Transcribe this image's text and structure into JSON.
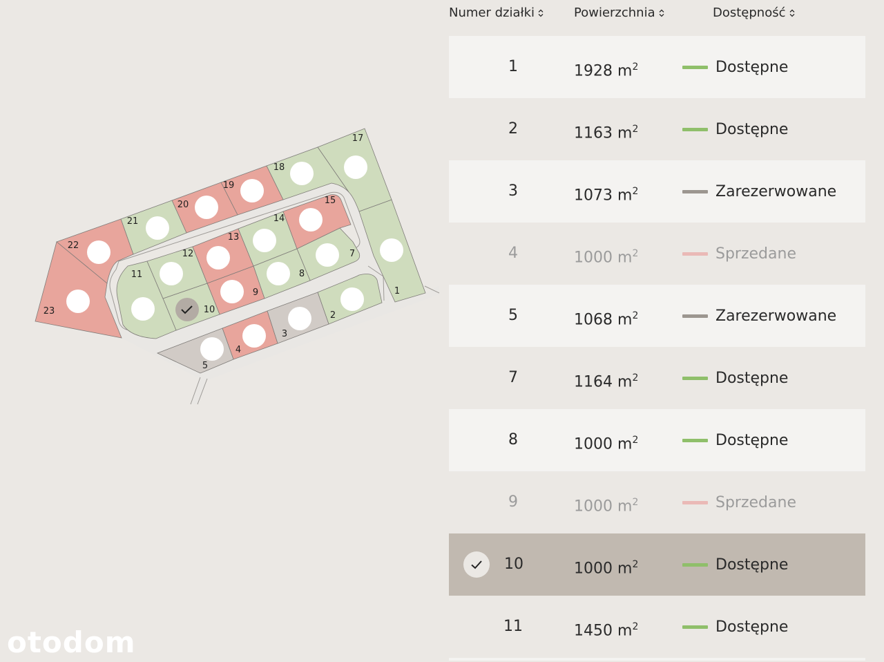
{
  "brand": {
    "logo_text": "otodom"
  },
  "table": {
    "headers": {
      "plot_number": "Numer działki",
      "area": "Powierzchnia",
      "availability": "Dostępność"
    },
    "area_unit": "m",
    "area_exp": "2",
    "rows": [
      {
        "number": "1",
        "area": "1928",
        "status": "Dostępne"
      },
      {
        "number": "2",
        "area": "1163",
        "status": "Dostępne"
      },
      {
        "number": "3",
        "area": "1073",
        "status": "Zarezerwowane"
      },
      {
        "number": "4",
        "area": "1000",
        "status": "Sprzedane"
      },
      {
        "number": "5",
        "area": "1068",
        "status": "Zarezerwowane"
      },
      {
        "number": "7",
        "area": "1164",
        "status": "Dostępne"
      },
      {
        "number": "8",
        "area": "1000",
        "status": "Dostępne"
      },
      {
        "number": "9",
        "area": "1000",
        "status": "Sprzedane"
      },
      {
        "number": "10",
        "area": "1000",
        "status": "Dostępne",
        "selected": true
      },
      {
        "number": "11",
        "area": "1450",
        "status": "Dostępne"
      }
    ]
  },
  "colors": {
    "available": "#8fbf6a",
    "reserved": "#9c9690",
    "sold": "#eab9b6",
    "plot_available": "#cfdcbd",
    "plot_sold": "#e8a59c",
    "plot_reserved": "#d1cbc6",
    "selected_row": "#c1b9b0"
  },
  "map": {
    "plots": [
      {
        "label": "1",
        "status": "available"
      },
      {
        "label": "2",
        "status": "available"
      },
      {
        "label": "3",
        "status": "reserved"
      },
      {
        "label": "4",
        "status": "sold"
      },
      {
        "label": "5",
        "status": "reserved"
      },
      {
        "label": "7",
        "status": "available"
      },
      {
        "label": "8",
        "status": "available"
      },
      {
        "label": "9",
        "status": "sold"
      },
      {
        "label": "10",
        "status": "available",
        "selected": true
      },
      {
        "label": "11",
        "status": "available"
      },
      {
        "label": "12",
        "status": "available"
      },
      {
        "label": "13",
        "status": "sold"
      },
      {
        "label": "14",
        "status": "available"
      },
      {
        "label": "15",
        "status": "sold"
      },
      {
        "label": "17",
        "status": "available"
      },
      {
        "label": "18",
        "status": "available"
      },
      {
        "label": "19",
        "status": "sold"
      },
      {
        "label": "20",
        "status": "sold"
      },
      {
        "label": "21",
        "status": "available"
      },
      {
        "label": "22",
        "status": "sold"
      },
      {
        "label": "23",
        "status": "sold"
      }
    ]
  }
}
